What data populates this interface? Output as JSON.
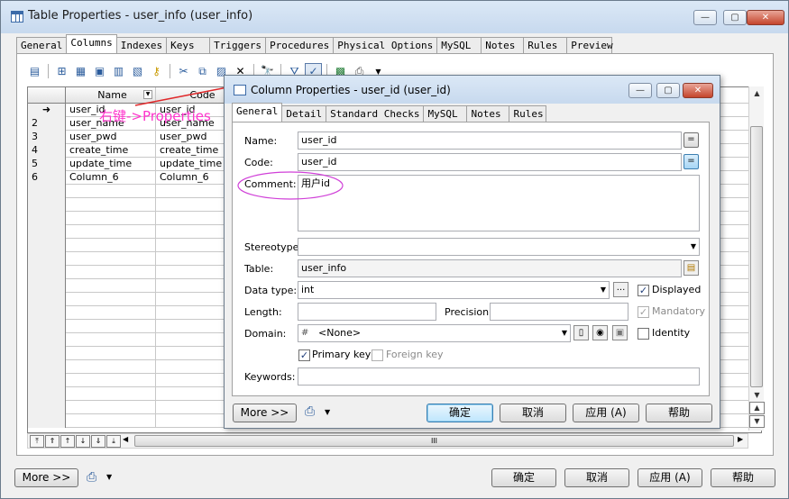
{
  "outer": {
    "title": "Table Properties - user_info (user_info)",
    "tabs": [
      "General",
      "Columns",
      "Indexes",
      "Keys",
      "Triggers",
      "Procedures",
      "Physical Options",
      "MySQL",
      "Notes",
      "Rules",
      "Preview"
    ],
    "active_tab": "Columns",
    "grid": {
      "headers": [
        "Name",
        "Code"
      ],
      "rows": [
        {
          "num": "",
          "name": "user_id",
          "code": "user_id"
        },
        {
          "num": "2",
          "name": "user_name",
          "code": "user_name"
        },
        {
          "num": "3",
          "name": "user_pwd",
          "code": "user_pwd"
        },
        {
          "num": "4",
          "name": "create_time",
          "code": "create_time"
        },
        {
          "num": "5",
          "name": "update_time",
          "code": "update_time"
        },
        {
          "num": "6",
          "name": "Column_6",
          "code": "Column_6"
        }
      ],
      "current_row_marker": "➜"
    },
    "hscroll_center": "III",
    "buttons": {
      "more": "More >>",
      "ok": "确定",
      "cancel": "取消",
      "apply": "应用 (A)",
      "help": "帮助"
    }
  },
  "annotation": {
    "text": "右键->Properties",
    "color": "#ff33cc",
    "arrow_color": "#e0282a"
  },
  "dialog": {
    "title": "Column Properties - user_id (user_id)",
    "tabs": [
      "General",
      "Detail",
      "Standard Checks",
      "MySQL",
      "Notes",
      "Rules"
    ],
    "active_tab": "General",
    "fields": {
      "name_label": "Name:",
      "name_value": "user_id",
      "code_label": "Code:",
      "code_value": "user_id",
      "comment_label": "Comment:",
      "comment_value": "用户id",
      "stereotype_label": "Stereotype:",
      "stereotype_value": "",
      "table_label": "Table:",
      "table_value": "user_info",
      "datatype_label": "Data type:",
      "datatype_value": "int",
      "length_label": "Length:",
      "length_value": "",
      "precision_label": "Precision:",
      "precision_value": "",
      "domain_label": "Domain:",
      "domain_value": "<None>",
      "keywords_label": "Keywords:",
      "keywords_value": ""
    },
    "checks": {
      "displayed": {
        "label": "Displayed",
        "checked": true
      },
      "mandatory": {
        "label": "Mandatory",
        "checked": true,
        "disabled": true
      },
      "identity": {
        "label": "Identity",
        "checked": false
      },
      "primary_key": {
        "label": "Primary key",
        "checked": true
      },
      "foreign_key": {
        "label": "Foreign key",
        "checked": false,
        "disabled": true
      }
    },
    "ellipsis": "...",
    "buttons": {
      "more": "More >>",
      "ok": "确定",
      "cancel": "取消",
      "apply": "应用 (A)",
      "help": "帮助"
    }
  }
}
